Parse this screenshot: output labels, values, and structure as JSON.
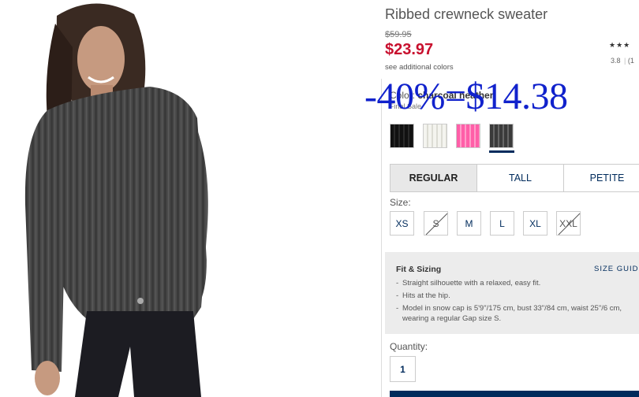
{
  "product": {
    "title": "Ribbed crewneck sweater",
    "original_price": "$59.95",
    "sale_price": "$23.97",
    "see_colors": "see additional colors",
    "rating_stars": "★★★",
    "rating_value": "3.8",
    "rating_count_partial": "(1",
    "overlay_discount": "-40%=$14.38"
  },
  "color": {
    "label": "Color:",
    "name": "charcoal heather",
    "final_sale": "Final Sale",
    "swatches": [
      {
        "name": "black",
        "color": "#1a1a1a"
      },
      {
        "name": "white",
        "color": "#f0f0ea"
      },
      {
        "name": "pink",
        "color": "#ff6fae"
      },
      {
        "name": "charcoal heather",
        "color": "#4a4a4a",
        "selected": true
      }
    ]
  },
  "fit_tabs": [
    "REGULAR",
    "TALL",
    "PETITE"
  ],
  "size": {
    "label": "Size:",
    "options": [
      {
        "label": "XS",
        "available": true
      },
      {
        "label": "S",
        "available": false
      },
      {
        "label": "M",
        "available": true
      },
      {
        "label": "L",
        "available": true
      },
      {
        "label": "XL",
        "available": true
      },
      {
        "label": "XXL",
        "available": false
      }
    ]
  },
  "fit_sizing": {
    "title": "Fit & Sizing",
    "guide_link": "SIZE GUID",
    "bullets": [
      "Straight silhouette with a relaxed, easy fit.",
      "Hits at the hip.",
      "Model in snow cap is 5'9\"/175 cm, bust 33\"/84 cm, waist 25\"/6 cm, wearing a regular Gap size S."
    ]
  },
  "quantity": {
    "label": "Quantity:",
    "value": "1"
  },
  "colors": {
    "sale_red": "#c8102e",
    "link_navy": "#002b5c",
    "overlay_blue": "#1122cc"
  }
}
